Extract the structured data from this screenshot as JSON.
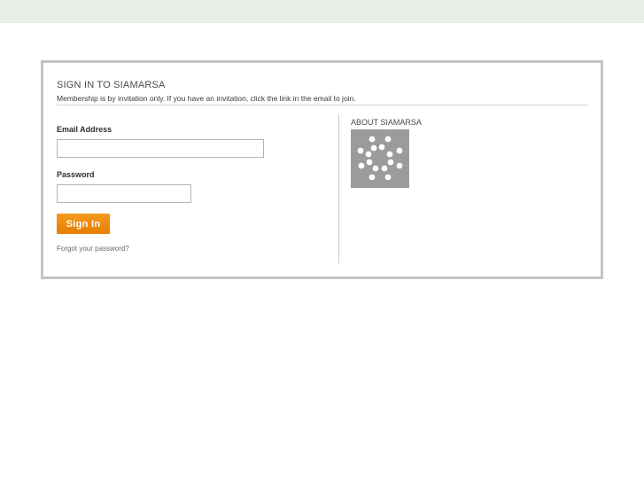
{
  "card": {
    "title": "SIGN IN TO SIAMARSA",
    "subtitle": "Membership is by invitation only. If you have an invitation, click the link in the email to join."
  },
  "form": {
    "email_label": "Email Address",
    "email_value": "",
    "password_label": "Password",
    "password_value": "",
    "signin_label": "Sign In",
    "forgot_label": "Forgot your password?"
  },
  "about": {
    "title": "ABOUT SIAMARSA",
    "logo_icon": "dot-cluster-logo"
  },
  "colors": {
    "top_bar": "#e8ede6",
    "card_border": "#c4c4c4",
    "button": "#f08c0f",
    "logo_bg": "#9b9b9b"
  }
}
